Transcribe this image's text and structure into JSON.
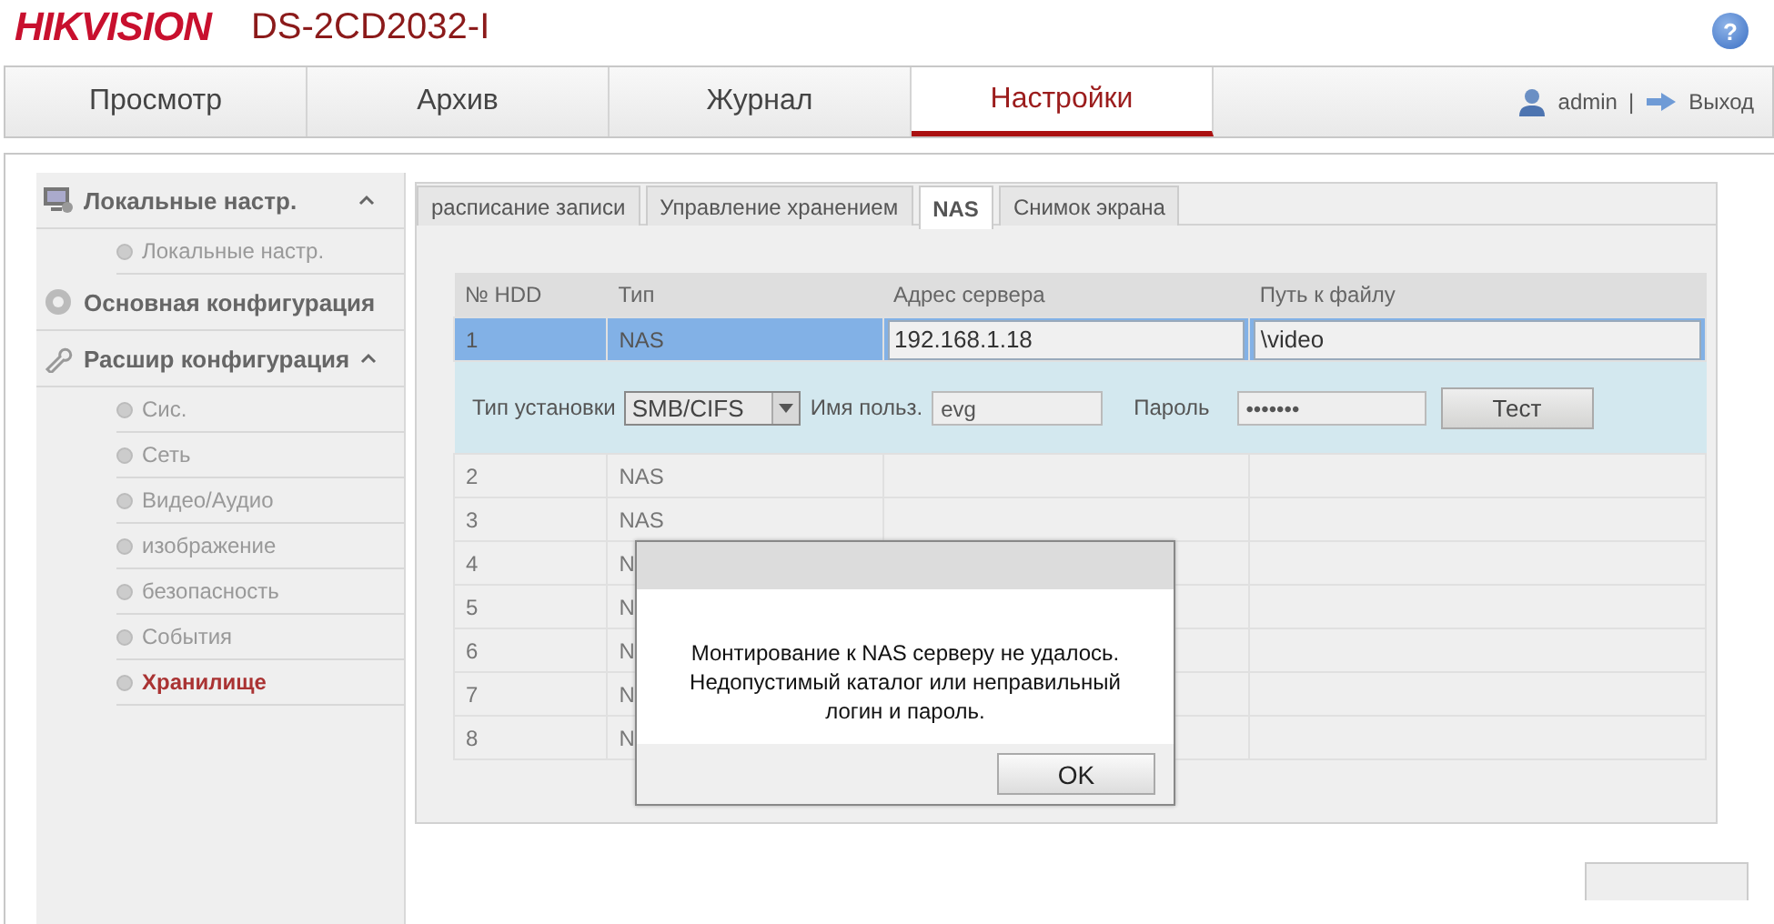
{
  "header": {
    "brand": "HIKVISION",
    "model": "DS-2CD2032-I",
    "help": "?"
  },
  "main_tabs": [
    {
      "label": "Просмотр",
      "selected": false
    },
    {
      "label": "Архив",
      "selected": false
    },
    {
      "label": "Журнал",
      "selected": false
    },
    {
      "label": "Настройки",
      "selected": true
    }
  ],
  "user": {
    "name": "admin",
    "separator": "|",
    "logout": "Выход"
  },
  "sidebar": {
    "groups": [
      {
        "label": "Локальные настр.",
        "kind": "monitor",
        "expanded": true,
        "children": [
          {
            "label": "Локальные настр.",
            "selected": false
          }
        ]
      },
      {
        "label": "Основная конфигурация",
        "kind": "gear",
        "expanded": false
      },
      {
        "label": "Расшир конфигурация",
        "kind": "wrench",
        "expanded": true,
        "children": [
          {
            "label": "Сис.",
            "selected": false
          },
          {
            "label": "Сеть",
            "selected": false
          },
          {
            "label": "Видео/Аудио",
            "selected": false
          },
          {
            "label": "изображение",
            "selected": false
          },
          {
            "label": "безопасность",
            "selected": false
          },
          {
            "label": "События",
            "selected": false
          },
          {
            "label": "Хранилище",
            "selected": true
          }
        ]
      }
    ]
  },
  "sub_tabs": [
    {
      "label": "расписание записи",
      "selected": false
    },
    {
      "label": "Управление хранением",
      "selected": false
    },
    {
      "label": "NAS",
      "selected": true
    },
    {
      "label": "Снимок экрана",
      "selected": false
    }
  ],
  "table": {
    "columns": [
      "№ HDD",
      "Тип",
      "Адрес сервера",
      "Путь к файлу"
    ],
    "rows": [
      {
        "number": "1",
        "type": "NAS",
        "server": "192.168.1.18",
        "path": "\\video",
        "selected": true
      },
      {
        "number": "2",
        "type": "NAS",
        "selected": false
      },
      {
        "number": "3",
        "type": "NAS",
        "selected": false
      },
      {
        "number": "4",
        "type": "N",
        "selected": false
      },
      {
        "number": "5",
        "type": "N",
        "selected": false
      },
      {
        "number": "6",
        "type": "N",
        "selected": false
      },
      {
        "number": "7",
        "type": "N",
        "selected": false
      },
      {
        "number": "8",
        "type": "N",
        "selected": false
      }
    ],
    "details": {
      "mount_label": "Тип установки",
      "mount_value": "SMB/CIFS",
      "user_label": "Имя польз.",
      "user_value": "evg",
      "password_label": "Пароль",
      "password_value": "•••••••",
      "test_button": "Тест"
    }
  },
  "dialog": {
    "message": "Монтирование к NAS серверу не удалось. Недопустимый каталог или неправильный логин и пароль.",
    "ok": "OK"
  }
}
